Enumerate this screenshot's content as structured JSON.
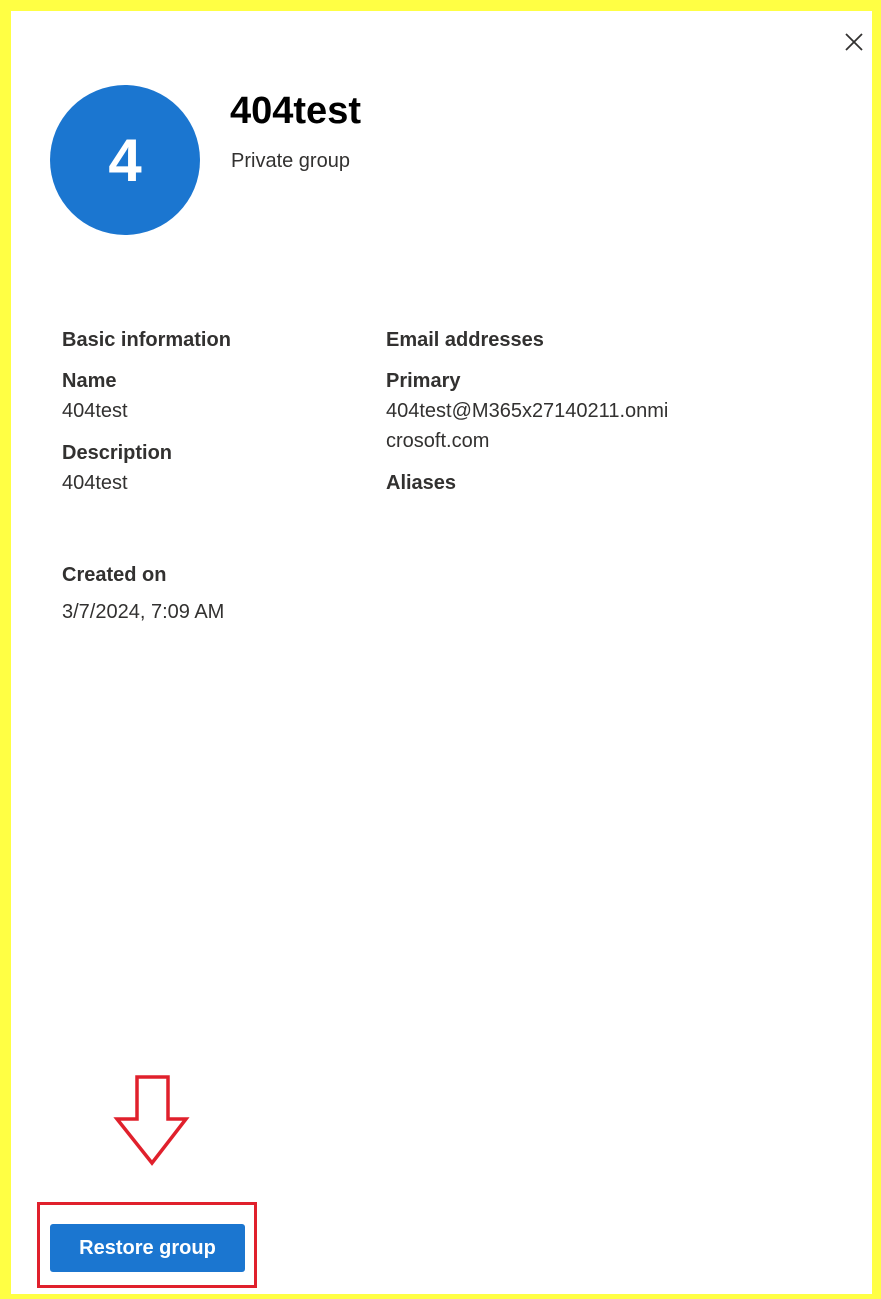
{
  "header": {
    "avatar_initial": "4",
    "title": "404test",
    "subtitle": "Private group",
    "close_icon": "close-icon"
  },
  "basic_information": {
    "heading": "Basic information",
    "name_label": "Name",
    "name_value": "404test",
    "description_label": "Description",
    "description_value": "404test"
  },
  "email_addresses": {
    "heading": "Email addresses",
    "primary_label": "Primary",
    "primary_value_line1": "404test@M365x27140211.onmi",
    "primary_value_line2": "crosoft.com",
    "aliases_label": "Aliases"
  },
  "created": {
    "label": "Created on",
    "value": "3/7/2024, 7:09 AM"
  },
  "footer": {
    "restore_label": "Restore group"
  },
  "colors": {
    "accent": "#1b76d0",
    "highlight_border": "#ffff44",
    "annotation_red": "#e0202c"
  }
}
